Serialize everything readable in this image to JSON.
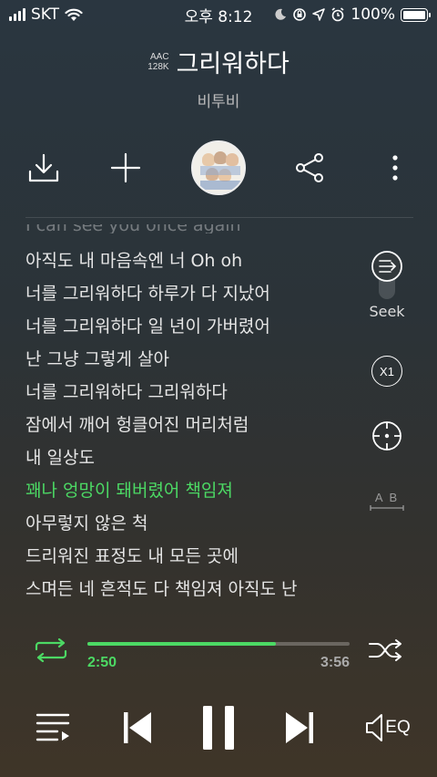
{
  "status_bar": {
    "carrier": "SKT",
    "time": "오후 8:12",
    "battery": "100%"
  },
  "song": {
    "quality_line1": "AAC",
    "quality_line2": "128K",
    "title": "그리워하다",
    "artist": "비투비"
  },
  "actions": {
    "download_icon": "download-icon",
    "add_icon": "plus-icon",
    "share_icon": "share-icon",
    "more_icon": "more-vertical-icon"
  },
  "lyrics": {
    "partial_top": "I can see you once again",
    "lines": [
      "아직도 내 마음속엔 너 Oh oh",
      "너를 그리워하다 하루가 다 지났어",
      "너를 그리워하다 일 년이 가버렸어",
      "난 그냥 그렇게 살아",
      "너를 그리워하다 그리워하다",
      "잠에서 깨어 헝클어진 머리처럼",
      "내 일상도",
      "꽤나 엉망이 돼버렸어 책임져",
      "아무렇지 않은 척",
      "드리워진 표정도 내 모든 곳에",
      "스며든 네 흔적도 다 책임져 아직도 난"
    ],
    "active_index": 7
  },
  "side_tools": {
    "seek_label": "Seek",
    "speed_label": "X1",
    "ab_label": "A B"
  },
  "playback": {
    "current_time": "2:50",
    "total_time": "3:56",
    "progress_fraction": 0.72
  },
  "controls": {
    "eq_label": "EQ"
  },
  "colors": {
    "accent": "#4cd964"
  }
}
